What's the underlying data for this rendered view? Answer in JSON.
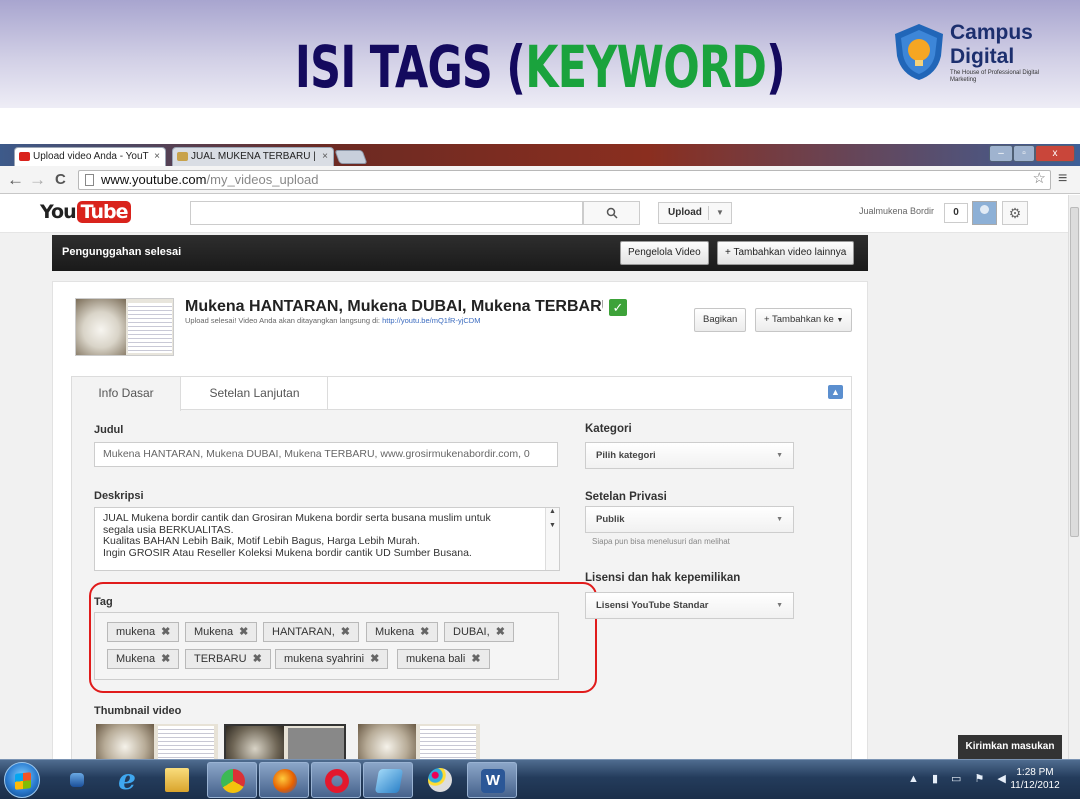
{
  "slide": {
    "title_main": "ISI TAGS (",
    "title_keyword": "KEYWORD",
    "title_end": ")",
    "brand_line1": "Campus",
    "brand_line2": "Digital",
    "brand_tagline": "The House of Professional Digital Marketing",
    "keyword_color": "#1aa33d",
    "title_color": "#140a5e"
  },
  "browser": {
    "tabs": [
      {
        "label": "Upload video Anda - YouT",
        "close": "×"
      },
      {
        "label": "JUAL MUKENA TERBARU |",
        "close": "×"
      }
    ],
    "url_host": "www.youtube.com",
    "url_path": "/my_videos_upload",
    "nav": {
      "back": "←",
      "forward": "→",
      "reload": "C",
      "star": "☆",
      "menu": "≡"
    },
    "window_buttons": {
      "min": "–",
      "max": "▫",
      "close": "x"
    }
  },
  "youtube": {
    "logo_you": "You",
    "logo_tube": "Tube",
    "search_placeholder": "",
    "search_icon": "search-icon",
    "upload_label": "Upload",
    "username": "Jualmukena Bordir",
    "notif_count": "0",
    "done_text": "Pengunggahan selesai",
    "manager_btn": "Pengelola Video",
    "add_more_btn": "+ Tambahkan video lainnya",
    "video_title": "Mukena HANTARAN, Mukena DUBAI, Mukena TERBARU, w",
    "upload_note": "Upload selesai! Video Anda akan ditayangkan langsung di: ",
    "video_link": "http://youtu.be/mQ1fR-yjCDM",
    "share_btn": "Bagikan",
    "add_to_btn": "+ Tambahkan ke",
    "tab_basic": "Info Dasar",
    "tab_advanced": "Setelan Lanjutan",
    "label_title": "Judul",
    "title_value": "Mukena HANTARAN, Mukena DUBAI, Mukena TERBARU, www.grosirmukenabordir.com, 0",
    "label_desc": "Deskripsi",
    "desc_value": "JUAL Mukena bordir cantik dan Grosiran Mukena bordir serta busana muslim untuk\nsegala usia BERKUALITAS.\nKualitas BAHAN Lebih Baik, Motif Lebih Bagus, Harga Lebih Murah.\nIngin GROSIR Atau Reseller Koleksi Mukena bordir cantik UD Sumber Busana.",
    "label_tags": "Tag",
    "tags": [
      "mukena",
      "Mukena",
      "HANTARAN,",
      "Mukena",
      "DUBAI,",
      "Mukena",
      "TERBARU",
      "mukena syahrini",
      "mukena bali"
    ],
    "tag_remove": "✖",
    "label_category": "Kategori",
    "category_value": "Pilih kategori",
    "label_privacy": "Setelan Privasi",
    "privacy_value": "Publik",
    "privacy_hint": "Siapa pun bisa menelusuri dan melihat",
    "label_license": "Lisensi dan hak kepemilikan",
    "license_value": "Lisensi YouTube Standar",
    "label_thumbnail": "Thumbnail video",
    "feedback": "Kirimkan masukan",
    "highlight_color": "#e01b1b"
  },
  "taskbar": {
    "clock_time": "1:28 PM",
    "clock_date": "11/12/2012",
    "tray_arrow": "▲"
  }
}
